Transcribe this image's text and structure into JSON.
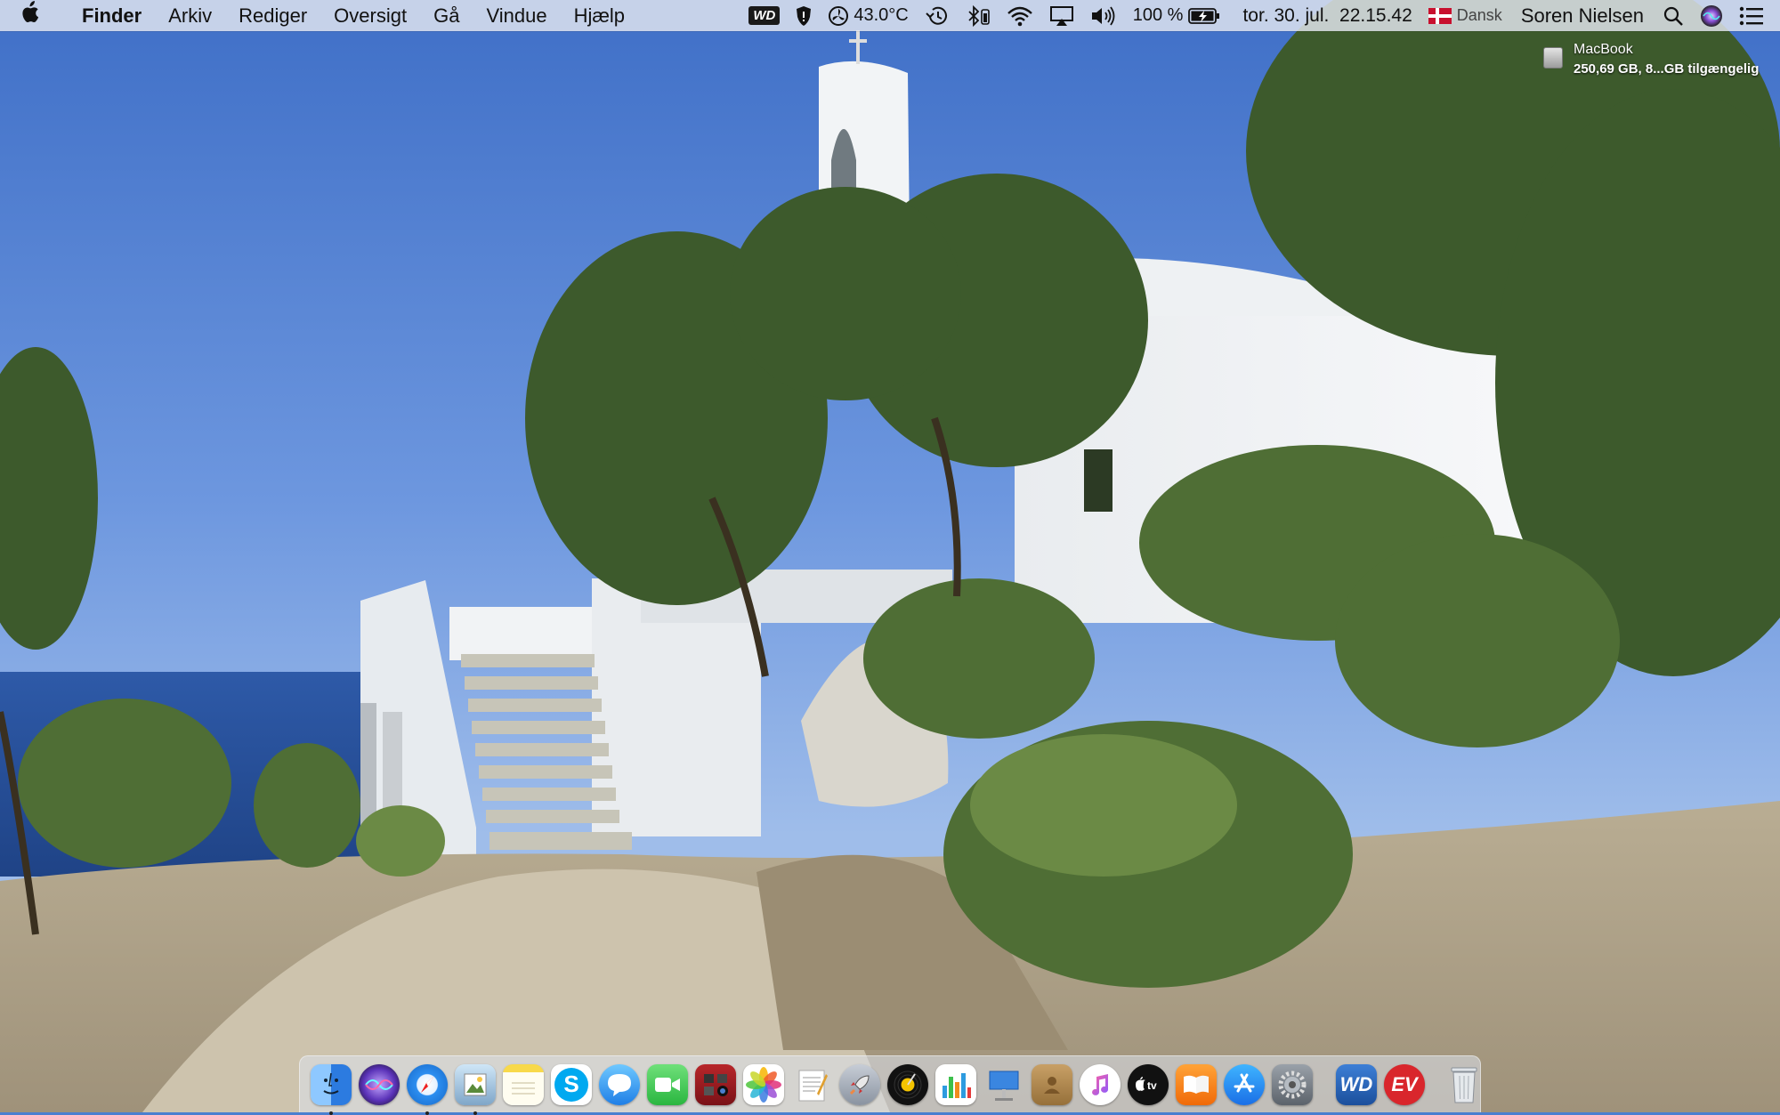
{
  "menubar": {
    "app_name": "Finder",
    "menus": [
      "Arkiv",
      "Rediger",
      "Oversigt",
      "Gå",
      "Vindue",
      "Hjælp"
    ],
    "wd_label": "WD",
    "temperature": "43.0°C",
    "battery": "100 %",
    "datetime": "tor. 30. jul.  22.15.42",
    "input_source": "Dansk",
    "user": "Soren Nielsen"
  },
  "desktop": {
    "disk_name": "MacBook",
    "disk_info": "250,69 GB, 8...GB tilgængelig"
  },
  "dock": {
    "wd_label": "WD",
    "ev_label": "EV",
    "skype_label": "S"
  }
}
